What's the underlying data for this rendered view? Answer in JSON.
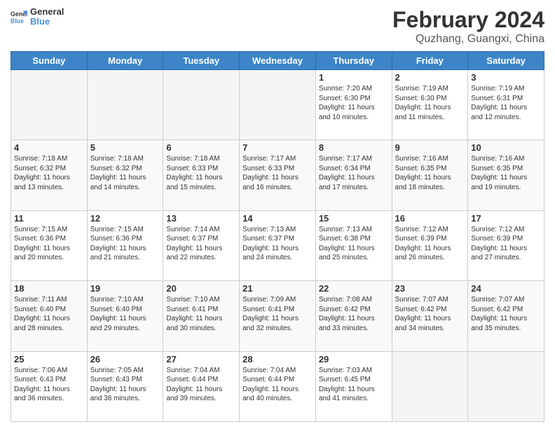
{
  "header": {
    "logo_general": "General",
    "logo_blue": "Blue",
    "title": "February 2024",
    "subtitle": "Quzhang, Guangxi, China"
  },
  "weekdays": [
    "Sunday",
    "Monday",
    "Tuesday",
    "Wednesday",
    "Thursday",
    "Friday",
    "Saturday"
  ],
  "weeks": [
    [
      {
        "day": "",
        "info": ""
      },
      {
        "day": "",
        "info": ""
      },
      {
        "day": "",
        "info": ""
      },
      {
        "day": "",
        "info": ""
      },
      {
        "day": "1",
        "info": "Sunrise: 7:20 AM\nSunset: 6:30 PM\nDaylight: 11 hours\nand 10 minutes."
      },
      {
        "day": "2",
        "info": "Sunrise: 7:19 AM\nSunset: 6:30 PM\nDaylight: 11 hours\nand 11 minutes."
      },
      {
        "day": "3",
        "info": "Sunrise: 7:19 AM\nSunset: 6:31 PM\nDaylight: 11 hours\nand 12 minutes."
      }
    ],
    [
      {
        "day": "4",
        "info": "Sunrise: 7:18 AM\nSunset: 6:32 PM\nDaylight: 11 hours\nand 13 minutes."
      },
      {
        "day": "5",
        "info": "Sunrise: 7:18 AM\nSunset: 6:32 PM\nDaylight: 11 hours\nand 14 minutes."
      },
      {
        "day": "6",
        "info": "Sunrise: 7:18 AM\nSunset: 6:33 PM\nDaylight: 11 hours\nand 15 minutes."
      },
      {
        "day": "7",
        "info": "Sunrise: 7:17 AM\nSunset: 6:33 PM\nDaylight: 11 hours\nand 16 minutes."
      },
      {
        "day": "8",
        "info": "Sunrise: 7:17 AM\nSunset: 6:34 PM\nDaylight: 11 hours\nand 17 minutes."
      },
      {
        "day": "9",
        "info": "Sunrise: 7:16 AM\nSunset: 6:35 PM\nDaylight: 11 hours\nand 18 minutes."
      },
      {
        "day": "10",
        "info": "Sunrise: 7:16 AM\nSunset: 6:35 PM\nDaylight: 11 hours\nand 19 minutes."
      }
    ],
    [
      {
        "day": "11",
        "info": "Sunrise: 7:15 AM\nSunset: 6:36 PM\nDaylight: 11 hours\nand 20 minutes."
      },
      {
        "day": "12",
        "info": "Sunrise: 7:15 AM\nSunset: 6:36 PM\nDaylight: 11 hours\nand 21 minutes."
      },
      {
        "day": "13",
        "info": "Sunrise: 7:14 AM\nSunset: 6:37 PM\nDaylight: 11 hours\nand 22 minutes."
      },
      {
        "day": "14",
        "info": "Sunrise: 7:13 AM\nSunset: 6:37 PM\nDaylight: 11 hours\nand 24 minutes."
      },
      {
        "day": "15",
        "info": "Sunrise: 7:13 AM\nSunset: 6:38 PM\nDaylight: 11 hours\nand 25 minutes."
      },
      {
        "day": "16",
        "info": "Sunrise: 7:12 AM\nSunset: 6:39 PM\nDaylight: 11 hours\nand 26 minutes."
      },
      {
        "day": "17",
        "info": "Sunrise: 7:12 AM\nSunset: 6:39 PM\nDaylight: 11 hours\nand 27 minutes."
      }
    ],
    [
      {
        "day": "18",
        "info": "Sunrise: 7:11 AM\nSunset: 6:40 PM\nDaylight: 11 hours\nand 28 minutes."
      },
      {
        "day": "19",
        "info": "Sunrise: 7:10 AM\nSunset: 6:40 PM\nDaylight: 11 hours\nand 29 minutes."
      },
      {
        "day": "20",
        "info": "Sunrise: 7:10 AM\nSunset: 6:41 PM\nDaylight: 11 hours\nand 30 minutes."
      },
      {
        "day": "21",
        "info": "Sunrise: 7:09 AM\nSunset: 6:41 PM\nDaylight: 11 hours\nand 32 minutes."
      },
      {
        "day": "22",
        "info": "Sunrise: 7:08 AM\nSunset: 6:42 PM\nDaylight: 11 hours\nand 33 minutes."
      },
      {
        "day": "23",
        "info": "Sunrise: 7:07 AM\nSunset: 6:42 PM\nDaylight: 11 hours\nand 34 minutes."
      },
      {
        "day": "24",
        "info": "Sunrise: 7:07 AM\nSunset: 6:42 PM\nDaylight: 11 hours\nand 35 minutes."
      }
    ],
    [
      {
        "day": "25",
        "info": "Sunrise: 7:06 AM\nSunset: 6:43 PM\nDaylight: 11 hours\nand 36 minutes."
      },
      {
        "day": "26",
        "info": "Sunrise: 7:05 AM\nSunset: 6:43 PM\nDaylight: 11 hours\nand 38 minutes."
      },
      {
        "day": "27",
        "info": "Sunrise: 7:04 AM\nSunset: 6:44 PM\nDaylight: 11 hours\nand 39 minutes."
      },
      {
        "day": "28",
        "info": "Sunrise: 7:04 AM\nSunset: 6:44 PM\nDaylight: 11 hours\nand 40 minutes."
      },
      {
        "day": "29",
        "info": "Sunrise: 7:03 AM\nSunset: 6:45 PM\nDaylight: 11 hours\nand 41 minutes."
      },
      {
        "day": "",
        "info": ""
      },
      {
        "day": "",
        "info": ""
      }
    ]
  ]
}
